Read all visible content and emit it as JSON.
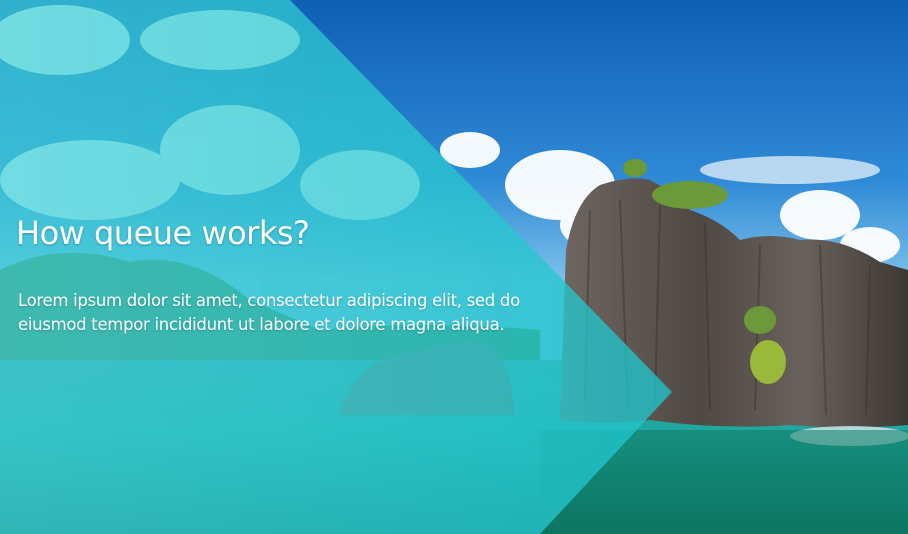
{
  "hero": {
    "title": "How queue works?",
    "body": "Lorem ipsum dolor sit amet, consectetur adipiscing elit, sed do eiusmod tempor incididunt ut labore et dolore magna aliqua."
  },
  "colors": {
    "overlay_teal": "#2ec9cf",
    "sky_blue": "#1a72c4",
    "sea_turquoise": "#2fb6b0",
    "rock_gray": "#5e5650",
    "foliage_green": "#6e9a3a"
  }
}
